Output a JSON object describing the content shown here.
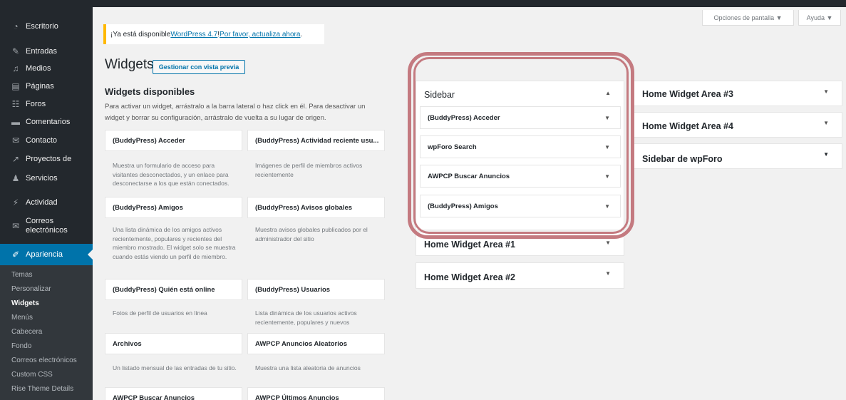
{
  "admin_menu": [
    {
      "label": "Escritorio",
      "icon": "dashboard-icon"
    },
    {
      "label": "Entradas",
      "icon": "pin-icon"
    },
    {
      "label": "Medios",
      "icon": "media-icon"
    },
    {
      "label": "Páginas",
      "icon": "page-icon"
    },
    {
      "label": "Foros",
      "icon": "forum-icon"
    },
    {
      "label": "Comentarios",
      "icon": "comment-icon"
    },
    {
      "label": "Contacto",
      "icon": "mail-icon"
    },
    {
      "label": "Proyectos de",
      "icon": "chart-icon"
    },
    {
      "label": "Servicios",
      "icon": "users-icon"
    },
    {
      "label": "Actividad",
      "icon": "activity-icon"
    },
    {
      "label": "Correos electrónicos",
      "icon": "mail-icon"
    },
    {
      "label": "Apariencia",
      "icon": "brush-icon"
    }
  ],
  "submenu": [
    "Temas",
    "Personalizar",
    "Widgets",
    "Menús",
    "Cabecera",
    "Fondo",
    "Correos electrónicos",
    "Custom CSS",
    "Rise Theme Details"
  ],
  "screen_options": {
    "label": "Opciones de pantalla ▼"
  },
  "help": {
    "label": "Ayuda ▼"
  },
  "notice": {
    "prefix": "¡Ya está disponible ",
    "link1": "WordPress 4.7",
    "middle": "! ",
    "link2": "Por favor, actualiza ahora",
    "suffix": "."
  },
  "page": {
    "title": "Widgets",
    "preview_button": "Gestionar con vista previa"
  },
  "available": {
    "title": "Widgets disponibles",
    "description": "Para activar un widget, arrástralo a la barra lateral o haz click en él. Para desactivar un widget y borrar su configuración, arrástralo de vuelta a su lugar de origen."
  },
  "widgets": [
    {
      "title": "(BuddyPress) Acceder",
      "desc": "Muestra un formulario de acceso para visitantes desconectados, y un enlace para desconectarse a los que están conectados."
    },
    {
      "title": "(BuddyPress) Actividad reciente usu...",
      "desc": "Imágenes de perfil de miembros activos recientemente"
    },
    {
      "title": "(BuddyPress) Amigos",
      "desc": "Una lista dinámica de los amigos activos recientemente, populares y recientes del miembro mostrado. El widget solo se muestra cuando estás viendo un perfil de miembro."
    },
    {
      "title": "(BuddyPress) Avisos globales",
      "desc": "Muestra avisos globales publicados por el administrador del sitio"
    },
    {
      "title": "(BuddyPress) Quién está online",
      "desc": "Fotos de perfil de usuarios en línea"
    },
    {
      "title": "(BuddyPress) Usuarios",
      "desc": "Lista dinámica de los usuarios activos recientemente, populares y nuevos"
    },
    {
      "title": "Archivos",
      "desc": "Un listado mensual de las entradas de tu sitio."
    },
    {
      "title": "AWPCP Anuncios Aleatorios",
      "desc": "Muestra una lista aleatoria de anuncios"
    },
    {
      "title": "AWPCP Buscar Anuncios",
      "desc": ""
    },
    {
      "title": "AWPCP Últimos Anuncios",
      "desc": ""
    }
  ],
  "sidebar_area": {
    "title": "Sidebar",
    "widgets": [
      "(BuddyPress) Acceder",
      "wpForo Search",
      "AWPCP Buscar Anuncios",
      "(BuddyPress) Amigos"
    ]
  },
  "areas_mid": [
    "Home Widget Area #1",
    "Home Widget Area #2"
  ],
  "areas_right": [
    "Home Widget Area #3",
    "Home Widget Area #4",
    "Sidebar de wpForo"
  ],
  "colors": {
    "accent": "#0073aa",
    "highlight": "#c47a80",
    "notice": "#ffb900"
  }
}
